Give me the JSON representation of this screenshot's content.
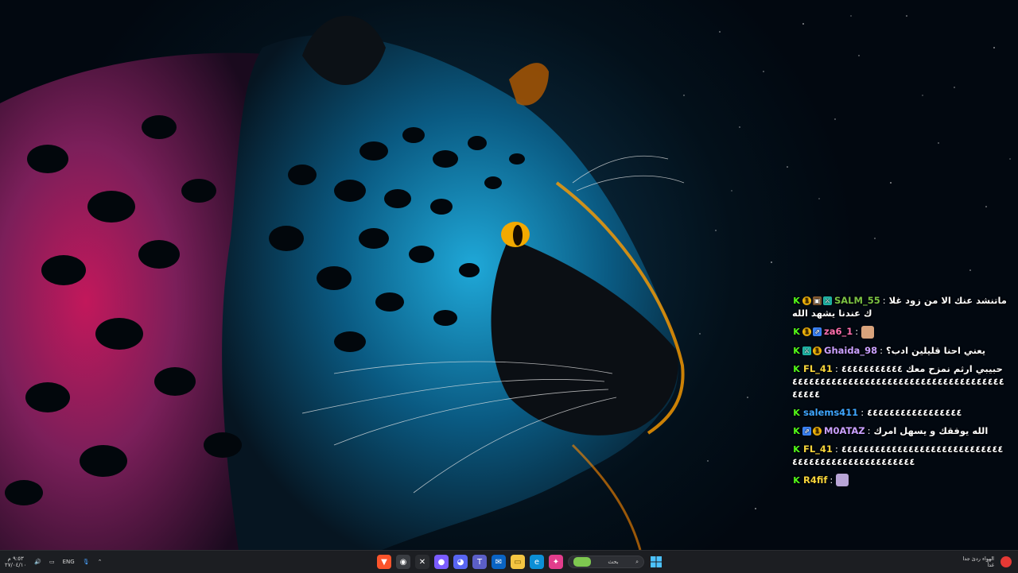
{
  "chat": {
    "messages": [
      {
        "user": "SALM_55",
        "color": "#7ac143",
        "sep": ":",
        "text": "ماتنشد عنك الا من زود غلاك عندنا يشهد الله",
        "badges": [
          "kick",
          "sub",
          "og",
          "mod"
        ]
      },
      {
        "user": "za6_1",
        "color": "#ff6fae",
        "sep": ":",
        "text": "",
        "badges": [
          "kick",
          "sub",
          "gift"
        ],
        "emote": "#d9a37c"
      },
      {
        "user": "Ghaida_98",
        "color": "#c9a0ff",
        "sep": ":",
        "text": "يعني احنا قليلين ادب؟",
        "badges": [
          "kick",
          "mod",
          "sub"
        ]
      },
      {
        "user": "FL_41",
        "color": "#f7d53b",
        "sep": ":",
        "text": "حبيبي ارثم نمزح معك ٤٤٤٤٤٤٤٤٤٤٤٤٤٤٤٤٤٤٤٤٤٤٤٤٤٤٤٤٤٤٤٤٤٤٤٤٤٤٤٤٤٤٤٤٤٤٤٤٤٤٤٤٤٤",
        "badges": [
          "kick"
        ]
      },
      {
        "user": "salems411",
        "color": "#3ea6ff",
        "sep": ":",
        "text": "٤٤٤٤٤٤٤٤٤٤٤٤٤٤٤٤٤",
        "badges": [
          "kick"
        ]
      },
      {
        "user": "M0ATAZ",
        "color": "#c9a0ff",
        "sep": ":",
        "text": "الله يوفقك و يسهل امرك",
        "badges": [
          "kick",
          "gift",
          "sub"
        ]
      },
      {
        "user": "FL_41",
        "color": "#f7d53b",
        "sep": ":",
        "text": "٤٤٤٤٤٤٤٤٤٤٤٤٤٤٤٤٤٤٤٤٤٤٤٤٤٤٤٤٤٤٤٤٤٤٤٤٤٤٤٤٤٤٤٤٤٤٤٤٤٤٤",
        "badges": [
          "kick"
        ]
      },
      {
        "user": "R4fif",
        "color": "#f7d53b",
        "sep": ":",
        "text": "",
        "badges": [
          "kick"
        ],
        "emote": "#b9a5d6"
      }
    ]
  },
  "taskbar": {
    "clock_time": "٩:٥٣ م",
    "clock_date": "٢٧/٠٤/١٠",
    "language": "ENG",
    "search_placeholder": "بحث",
    "weather_text": "الهواء ردئ جدا",
    "weather_sub": "غداً"
  },
  "colors": {
    "taskbar_bg": "#1c1e22",
    "kick_green": "#53fc18"
  }
}
